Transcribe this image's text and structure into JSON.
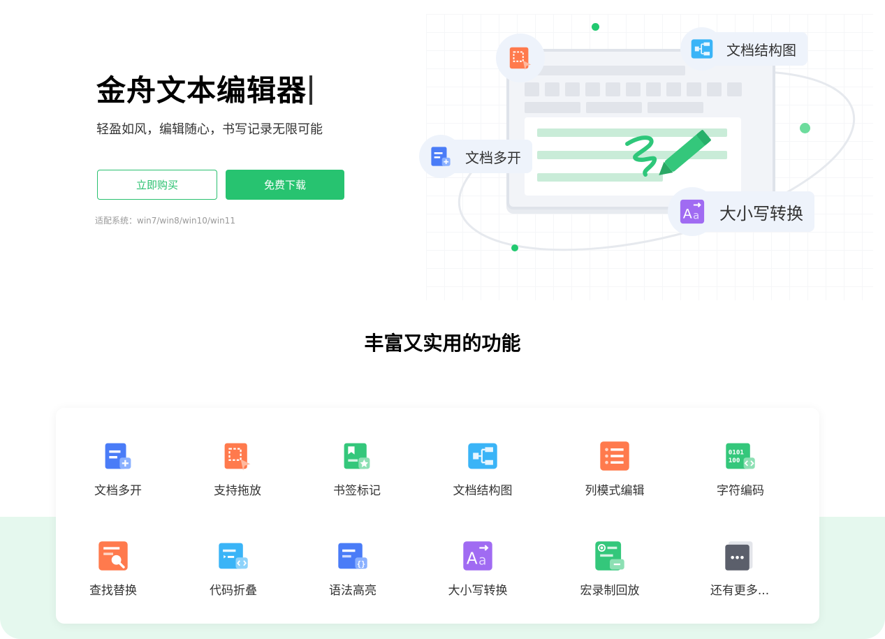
{
  "hero": {
    "title": "金舟文本编辑器",
    "subtitle": "轻盈如风，编辑随心，书写记录无限可能",
    "buy_label": "立即购买",
    "download_label": "免费下载",
    "compat": "适配系统：win7/win8/win10/win11"
  },
  "illustration": {
    "chips": {
      "structure": "文档结构图",
      "multi": "文档多开",
      "case": "大小写转换"
    }
  },
  "features": {
    "title": "丰富又实用的功能",
    "items": [
      {
        "label": "文档多开",
        "icon": "doc-multi-icon"
      },
      {
        "label": "支持拖放",
        "icon": "drag-drop-icon"
      },
      {
        "label": "书签标记",
        "icon": "bookmark-icon"
      },
      {
        "label": "文档结构图",
        "icon": "doc-structure-icon"
      },
      {
        "label": "列模式编辑",
        "icon": "column-edit-icon"
      },
      {
        "label": "字符编码",
        "icon": "char-encoding-icon"
      },
      {
        "label": "查找替换",
        "icon": "find-replace-icon"
      },
      {
        "label": "代码折叠",
        "icon": "code-fold-icon"
      },
      {
        "label": "语法高亮",
        "icon": "syntax-highlight-icon"
      },
      {
        "label": "大小写转换",
        "icon": "case-convert-icon"
      },
      {
        "label": "宏录制回放",
        "icon": "macro-record-icon"
      },
      {
        "label": "还有更多...",
        "icon": "more-icon"
      }
    ]
  },
  "colors": {
    "accent": "#27c370",
    "band": "#e5f8ee",
    "blue": "#4a7cf7",
    "orange": "#ff7a4d",
    "purple": "#a06bf2",
    "cyan": "#3ab4f7"
  }
}
